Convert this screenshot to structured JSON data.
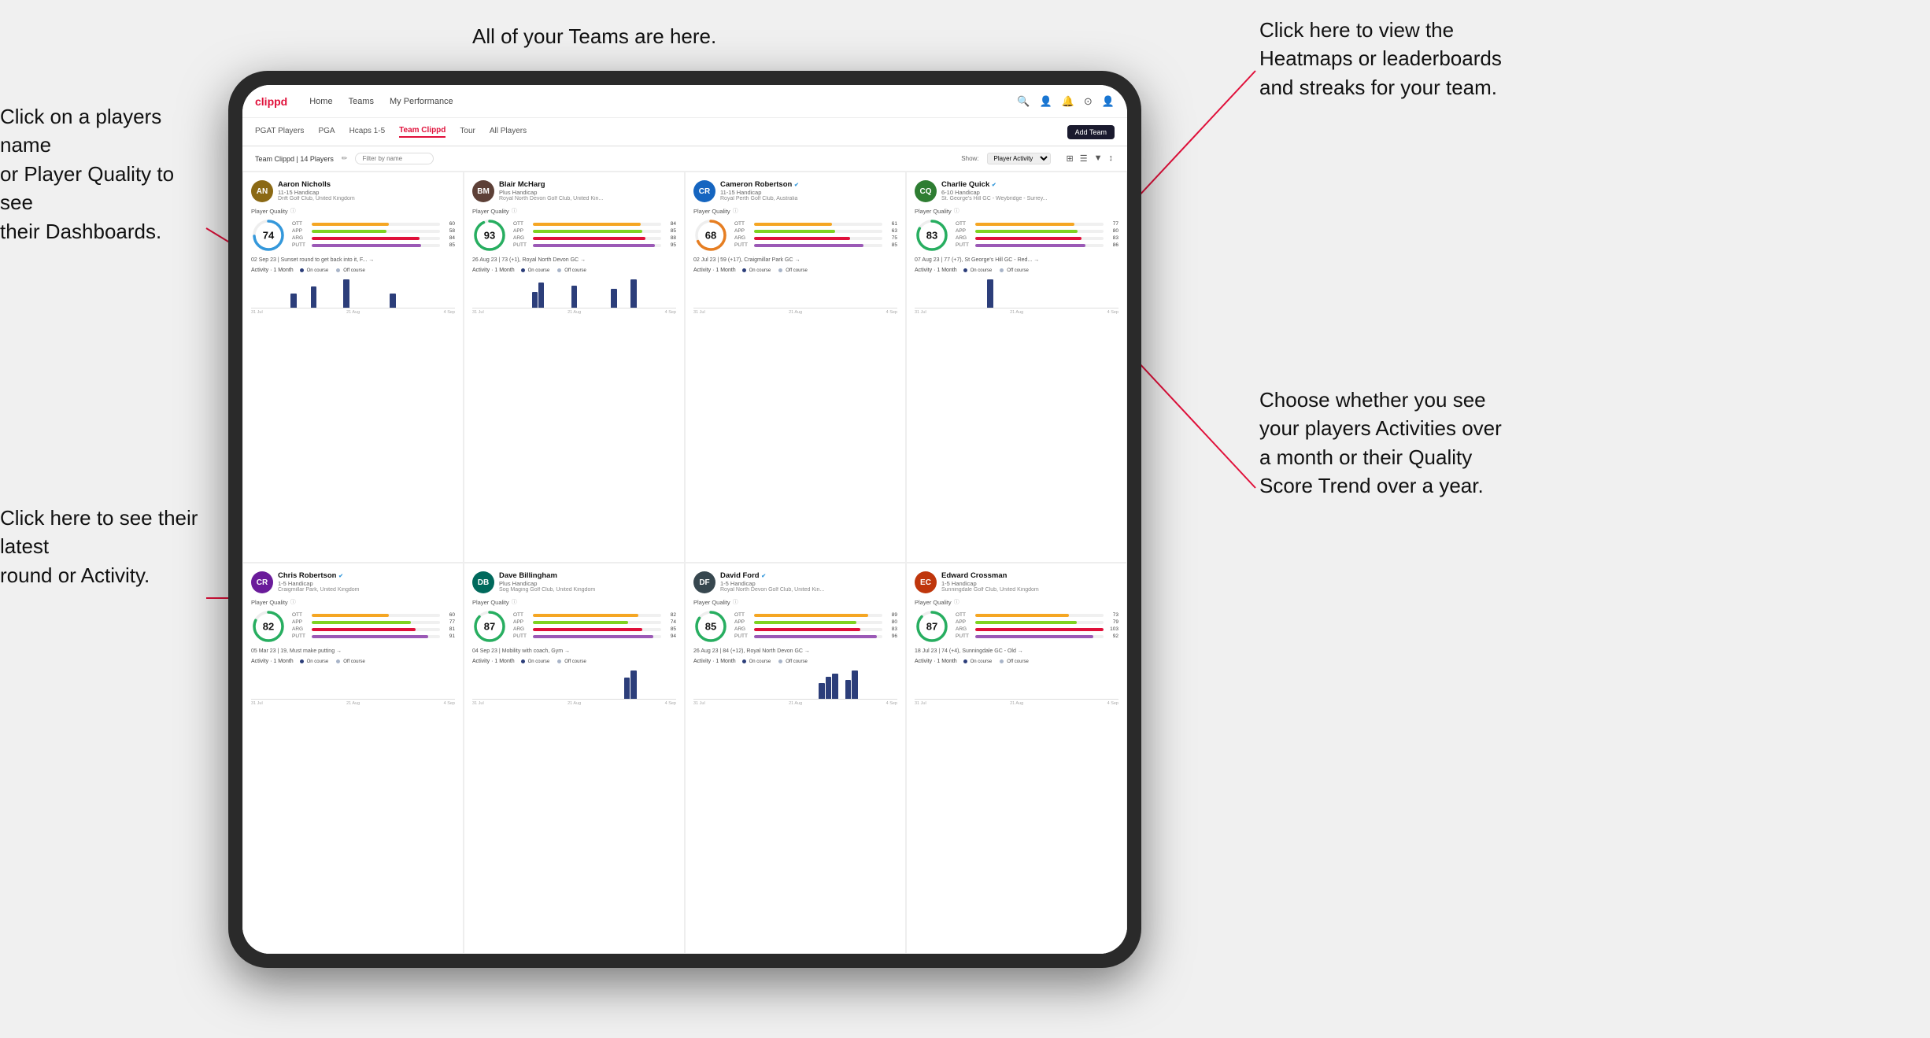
{
  "annotations": {
    "top_center": "All of your Teams are here.",
    "top_right": "Click here to view the\nHeatmaps or leaderboards\nand streaks for your team.",
    "left_top": "Click on a players name\nor Player Quality to see\ntheir Dashboards.",
    "left_bottom": "Click here to see their latest\nround or Activity.",
    "right_bottom": "Choose whether you see\nyour players Activities over\na month or their Quality\nScore Trend over a year."
  },
  "nav": {
    "logo": "clippd",
    "items": [
      "Home",
      "Teams",
      "My Performance"
    ],
    "icons": [
      "🔍",
      "👤",
      "🔔",
      "⊙",
      "👤"
    ]
  },
  "sub_tabs": {
    "items": [
      "PGAT Players",
      "PGA",
      "Hcaps 1-5",
      "Team Clippd",
      "Tour",
      "All Players"
    ],
    "active": "Team Clippd",
    "add_button": "Add Team"
  },
  "toolbar": {
    "team_label": "Team Clippd | 14 Players",
    "filter_placeholder": "Filter by name",
    "show_label": "Show:",
    "show_value": "Player Activity",
    "view_icons": [
      "⊞",
      "⊟",
      "▼",
      "↕"
    ]
  },
  "players": [
    {
      "name": "Aaron Nicholls",
      "handicap": "11-15 Handicap",
      "club": "Drift Golf Club, United Kingdom",
      "score": 74,
      "score_color": "#3498db",
      "stats": {
        "OTT": {
          "value": 60,
          "pct": 60
        },
        "APP": {
          "value": 58,
          "pct": 58
        },
        "ARG": {
          "value": 84,
          "pct": 84
        },
        "PUTT": {
          "value": 85,
          "pct": 85
        }
      },
      "recent": "02 Sep 23 | Sunset round to get back into it, F... →",
      "chart_bars": [
        0,
        0,
        0,
        0,
        0,
        0,
        2,
        0,
        0,
        3,
        0,
        0,
        0,
        0,
        4,
        0,
        0,
        0,
        0,
        0,
        0,
        2,
        0,
        0,
        0,
        0,
        0,
        0,
        0,
        0,
        0
      ],
      "chart_labels": [
        "31 Jul",
        "21 Aug",
        "4 Sep"
      ]
    },
    {
      "name": "Blair McHarg",
      "handicap": "Plus Handicap",
      "club": "Royal North Devon Golf Club, United Kin...",
      "score": 93,
      "score_color": "#27ae60",
      "stats": {
        "OTT": {
          "value": 84,
          "pct": 84
        },
        "APP": {
          "value": 85,
          "pct": 85
        },
        "ARG": {
          "value": 88,
          "pct": 88
        },
        "PUTT": {
          "value": 95,
          "pct": 95
        }
      },
      "recent": "26 Aug 23 | 73 (+1), Royal North Devon GC →",
      "chart_bars": [
        0,
        0,
        0,
        0,
        0,
        0,
        0,
        0,
        0,
        5,
        8,
        0,
        0,
        0,
        0,
        7,
        0,
        0,
        0,
        0,
        0,
        6,
        0,
        0,
        9,
        0,
        0,
        0,
        0,
        0,
        0
      ],
      "chart_labels": [
        "31 Jul",
        "21 Aug",
        "4 Sep"
      ]
    },
    {
      "name": "Cameron Robertson",
      "handicap": "11-15 Handicap",
      "club": "Royal Perth Golf Club, Australia",
      "score": 68,
      "score_color": "#e67e22",
      "verified": true,
      "stats": {
        "OTT": {
          "value": 61,
          "pct": 61
        },
        "APP": {
          "value": 63,
          "pct": 63
        },
        "ARG": {
          "value": 75,
          "pct": 75
        },
        "PUTT": {
          "value": 85,
          "pct": 85
        }
      },
      "recent": "02 Jul 23 | 59 (+17), Craigmillar Park GC →",
      "chart_bars": [
        0,
        0,
        0,
        0,
        0,
        0,
        0,
        0,
        0,
        0,
        0,
        0,
        0,
        0,
        0,
        0,
        0,
        0,
        0,
        0,
        0,
        0,
        0,
        0,
        0,
        0,
        0,
        0,
        0,
        0,
        0
      ],
      "chart_labels": [
        "31 Jul",
        "21 Aug",
        "4 Sep"
      ]
    },
    {
      "name": "Charlie Quick",
      "handicap": "6-10 Handicap",
      "club": "St. George's Hill GC - Weybridge - Surrey...",
      "score": 83,
      "score_color": "#27ae60",
      "verified": true,
      "stats": {
        "OTT": {
          "value": 77,
          "pct": 77
        },
        "APP": {
          "value": 80,
          "pct": 80
        },
        "ARG": {
          "value": 83,
          "pct": 83
        },
        "PUTT": {
          "value": 86,
          "pct": 86
        }
      },
      "recent": "07 Aug 23 | 77 (+7), St George's Hill GC - Red... →",
      "chart_bars": [
        0,
        0,
        0,
        0,
        0,
        0,
        0,
        0,
        0,
        0,
        0,
        3,
        0,
        0,
        0,
        0,
        0,
        0,
        0,
        0,
        0,
        0,
        0,
        0,
        0,
        0,
        0,
        0,
        0,
        0,
        0
      ],
      "chart_labels": [
        "31 Jul",
        "21 Aug",
        "4 Sep"
      ]
    },
    {
      "name": "Chris Robertson",
      "handicap": "1-5 Handicap",
      "club": "Craigmillar Park, United Kingdom",
      "score": 82,
      "score_color": "#27ae60",
      "verified": true,
      "stats": {
        "OTT": {
          "value": 60,
          "pct": 60
        },
        "APP": {
          "value": 77,
          "pct": 77
        },
        "ARG": {
          "value": 81,
          "pct": 81
        },
        "PUTT": {
          "value": 91,
          "pct": 91
        }
      },
      "recent": "05 Mar 23 | 19, Must make putting →",
      "chart_bars": [
        0,
        0,
        0,
        0,
        0,
        0,
        0,
        0,
        0,
        0,
        0,
        0,
        0,
        0,
        0,
        0,
        0,
        0,
        0,
        0,
        0,
        0,
        0,
        0,
        0,
        0,
        0,
        0,
        0,
        0,
        0
      ],
      "chart_labels": [
        "31 Jul",
        "21 Aug",
        "4 Sep"
      ]
    },
    {
      "name": "Dave Billingham",
      "handicap": "Plus Handicap",
      "club": "Sog Maging Golf Club, United Kingdom",
      "score": 87,
      "score_color": "#27ae60",
      "stats": {
        "OTT": {
          "value": 82,
          "pct": 82
        },
        "APP": {
          "value": 74,
          "pct": 74
        },
        "ARG": {
          "value": 85,
          "pct": 85
        },
        "PUTT": {
          "value": 94,
          "pct": 94
        }
      },
      "recent": "04 Sep 23 | Mobility with coach, Gym →",
      "chart_bars": [
        0,
        0,
        0,
        0,
        0,
        0,
        0,
        0,
        0,
        0,
        0,
        0,
        0,
        0,
        0,
        0,
        0,
        0,
        0,
        0,
        0,
        0,
        0,
        3,
        4,
        0,
        0,
        0,
        0,
        0,
        0
      ],
      "chart_labels": [
        "31 Jul",
        "21 Aug",
        "4 Sep"
      ]
    },
    {
      "name": "David Ford",
      "handicap": "1-5 Handicap",
      "club": "Royal North Devon Golf Club, United Kin...",
      "score": 85,
      "score_color": "#27ae60",
      "verified": true,
      "stats": {
        "OTT": {
          "value": 89,
          "pct": 89
        },
        "APP": {
          "value": 80,
          "pct": 80
        },
        "ARG": {
          "value": 83,
          "pct": 83
        },
        "PUTT": {
          "value": 96,
          "pct": 96
        }
      },
      "recent": "26 Aug 23 | 84 (+12), Royal North Devon GC →",
      "chart_bars": [
        0,
        0,
        0,
        0,
        0,
        0,
        0,
        0,
        0,
        0,
        0,
        0,
        0,
        0,
        0,
        0,
        0,
        0,
        0,
        5,
        7,
        8,
        0,
        6,
        9,
        0,
        0,
        0,
        0,
        0,
        0
      ],
      "chart_labels": [
        "31 Jul",
        "21 Aug",
        "4 Sep"
      ]
    },
    {
      "name": "Edward Crossman",
      "handicap": "1-5 Handicap",
      "club": "Sunningdale Golf Club, United Kingdom",
      "score": 87,
      "score_color": "#27ae60",
      "stats": {
        "OTT": {
          "value": 73,
          "pct": 73
        },
        "APP": {
          "value": 79,
          "pct": 79
        },
        "ARG": {
          "value": 103,
          "pct": 100
        },
        "PUTT": {
          "value": 92,
          "pct": 92
        }
      },
      "recent": "18 Jul 23 | 74 (+4), Sunningdale GC - Old →",
      "chart_bars": [
        0,
        0,
        0,
        0,
        0,
        0,
        0,
        0,
        0,
        0,
        0,
        0,
        0,
        0,
        0,
        0,
        0,
        0,
        0,
        0,
        0,
        0,
        0,
        0,
        0,
        0,
        0,
        0,
        0,
        0,
        0
      ],
      "chart_labels": [
        "31 Jul",
        "21 Aug",
        "4 Sep"
      ]
    }
  ],
  "activity": {
    "label": "Activity · 1 Month",
    "on_course": "On course",
    "off_course": "Off course"
  },
  "player_quality_label": "Player Quality"
}
